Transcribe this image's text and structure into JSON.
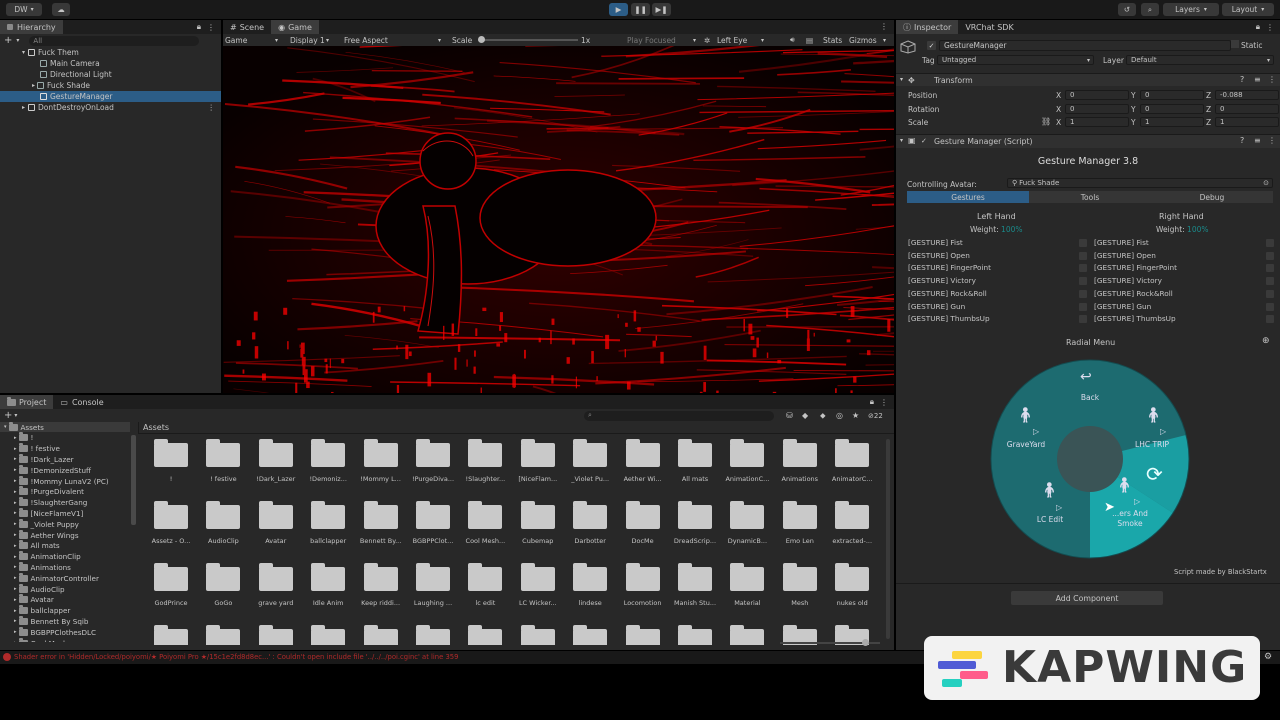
{
  "toolbar": {
    "account": "DW",
    "cloud_icon": "cloud-icon",
    "play_icon": "play-icon",
    "pause_icon": "pause-icon",
    "step_icon": "step-icon",
    "layers": "Layers",
    "layout": "Layout"
  },
  "hierarchy": {
    "tab": "Hierarchy",
    "search_placeholder": "All",
    "items": [
      {
        "label": "Fuck Them"
      },
      {
        "label": "Main Camera"
      },
      {
        "label": "Directional Light"
      },
      {
        "label": "Fuck Shade"
      },
      {
        "label": "GestureManager"
      },
      {
        "label": "DontDestroyOnLoad"
      }
    ]
  },
  "center_tabs": {
    "scene": "Scene",
    "game": "Game"
  },
  "game_toolbar": {
    "mode": "Game",
    "display": "Display 1",
    "aspect": "Free Aspect",
    "scale_label": "Scale",
    "scale_value": "1x",
    "play_focused": "Play Focused",
    "eye": "Left Eye",
    "stats": "Stats",
    "gizmos": "Gizmos"
  },
  "project": {
    "tab_project": "Project",
    "tab_console": "Console",
    "breadcrumb": "Assets",
    "count": "22",
    "tree": [
      "Assets",
      "!",
      "! festive",
      "!Dark_Lazer",
      "!DemonizedStuff",
      "!Mommy LunaV2 (PC)",
      "!PurgeDivalent",
      "!SlaughterGang",
      "[NiceFlameV1]",
      "_Violet Puppy",
      "Aether Wings",
      "All mats",
      "AnimationClip",
      "Animations",
      "AnimatorController",
      "AudioClip",
      "Avatar",
      "ballclapper",
      "Bennett By Sqib",
      "BGBPPClothesDLC",
      "Cool Meshes"
    ],
    "folders_row1": [
      "!",
      "! festive",
      "!Dark_Lazer",
      "!Demoniz...",
      "!Mommy L...",
      "!PurgeDiva...",
      "!Slaughter...",
      "[NiceFlam...",
      "_Violet Pu...",
      "Aether Wi...",
      "All mats",
      "AnimationC...",
      "Animations",
      "AnimatorC..."
    ],
    "folders_row2": [
      "Assetz - O...",
      "AudioClip",
      "Avatar",
      "ballclapper",
      "Bennett By...",
      "BGBPPClot...",
      "Cool Mesh...",
      "Cubemap",
      "Darbotter",
      "DocMe",
      "DreadScrip...",
      "DynamicB...",
      "Emo Len",
      "extracted-..."
    ],
    "folders_row3": [
      "GodPrince",
      "GoGo",
      "grave yard",
      "Idle Anim",
      "Keep riddi...",
      "Laughing ...",
      "lc edit",
      "LC Wicker...",
      "lindese",
      "Locomotion",
      "Manish Stu...",
      "Material",
      "Mesh",
      "nukes old"
    ]
  },
  "inspector": {
    "tab_inspector": "Inspector",
    "tab_sdk": "VRChat SDK",
    "object_name": "GestureManager",
    "static": "Static",
    "tag_label": "Tag",
    "tag_value": "Untagged",
    "layer_label": "Layer",
    "layer_value": "Default",
    "transform": {
      "title": "Transform",
      "position_label": "Position",
      "rotation_label": "Rotation",
      "scale_label": "Scale",
      "axis_x": "X",
      "axis_y": "Y",
      "axis_z": "Z",
      "position": [
        "0",
        "0",
        "-0.088"
      ],
      "rotation": [
        "0",
        "0",
        "0"
      ],
      "scale": [
        "1",
        "1",
        "1"
      ]
    },
    "script": {
      "title": "Gesture Manager (Script)",
      "heading": "Gesture Manager 3.8",
      "controlling_label": "Controlling Avatar:",
      "controlling_value": "Fuck Shade",
      "tabs": [
        "Gestures",
        "Tools",
        "Debug"
      ],
      "left_hand": "Left Hand",
      "right_hand": "Right Hand",
      "weight_label": "Weight:",
      "weight_value": "100%",
      "gestures": [
        "[GESTURE] Fist",
        "[GESTURE] Open",
        "[GESTURE] FingerPoint",
        "[GESTURE] Victory",
        "[GESTURE] Rock&Roll",
        "[GESTURE] Gun",
        "[GESTURE] ThumbsUp"
      ],
      "radial_title": "Radial Menu",
      "radial": {
        "back": "Back",
        "graveyard": "GraveYard",
        "lhc_trip": "LHC TRIP",
        "lc_edit": "LC Edit",
        "smoke_line1": "...ers And",
        "smoke_line2": "Smoke"
      },
      "credit": "Script made by BlackStartx"
    },
    "add_component": "Add Component"
  },
  "status": {
    "error": "Shader error in 'Hidden/Locked/poiyomi/★ Poiyomi Pro ★/15c1e2fd8d8ec...' : Couldn't open include file '../../../poi.cginc' at line 359"
  },
  "watermark": "KAPWING",
  "colors": {
    "accent": "#2c5d87",
    "radial": "#1d6b70",
    "radial_active": "#1aa7aa",
    "game_red": "#d00000",
    "error": "#b02a2a"
  }
}
